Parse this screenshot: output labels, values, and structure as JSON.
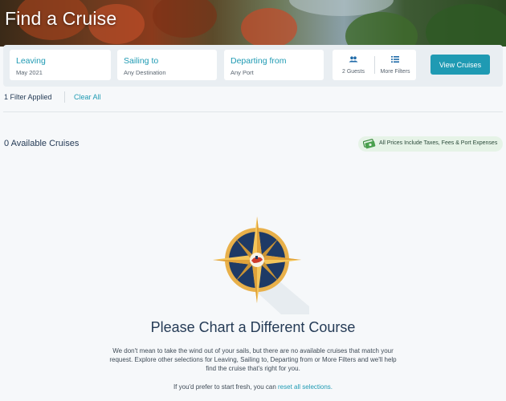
{
  "hero": {
    "title": "Find a Cruise"
  },
  "filters": {
    "leaving": {
      "label": "Leaving",
      "value": "May 2021"
    },
    "sailing_to": {
      "label": "Sailing to",
      "value": "Any Destination"
    },
    "departing_from": {
      "label": "Departing from",
      "value": "Any Port"
    },
    "guests": {
      "label": "2 Guests",
      "icon": "people-icon"
    },
    "more_filters": {
      "label": "More Filters",
      "icon": "list-filter-icon"
    },
    "view_button": "View Cruises"
  },
  "applied": {
    "text": "1 Filter Applied",
    "clear": "Clear All"
  },
  "results": {
    "count_text": "0 Available Cruises",
    "price_note": "All Prices Include Taxes, Fees & Port Expenses",
    "price_icon": "money-icon"
  },
  "empty_state": {
    "icon": "compass-icon",
    "heading": "Please Chart a Different Course",
    "body_line1": "We don't mean to take the wind out of your sails, but there are no available cruises that match your",
    "body_line2": "request. Explore other selections for Leaving, Sailing to, Departing from or More Filters and we'll help",
    "body_line3": "find the cruise that's right for you.",
    "reset_prefix": "If you'd prefer to start fresh, you can",
    "reset_link": "reset all selections."
  },
  "colors": {
    "accent": "#1f9ab3",
    "navy": "#253b56",
    "compass_gold": "#e8b04a",
    "compass_blue": "#1e3a66",
    "pill_green": "#e6f3e7"
  }
}
